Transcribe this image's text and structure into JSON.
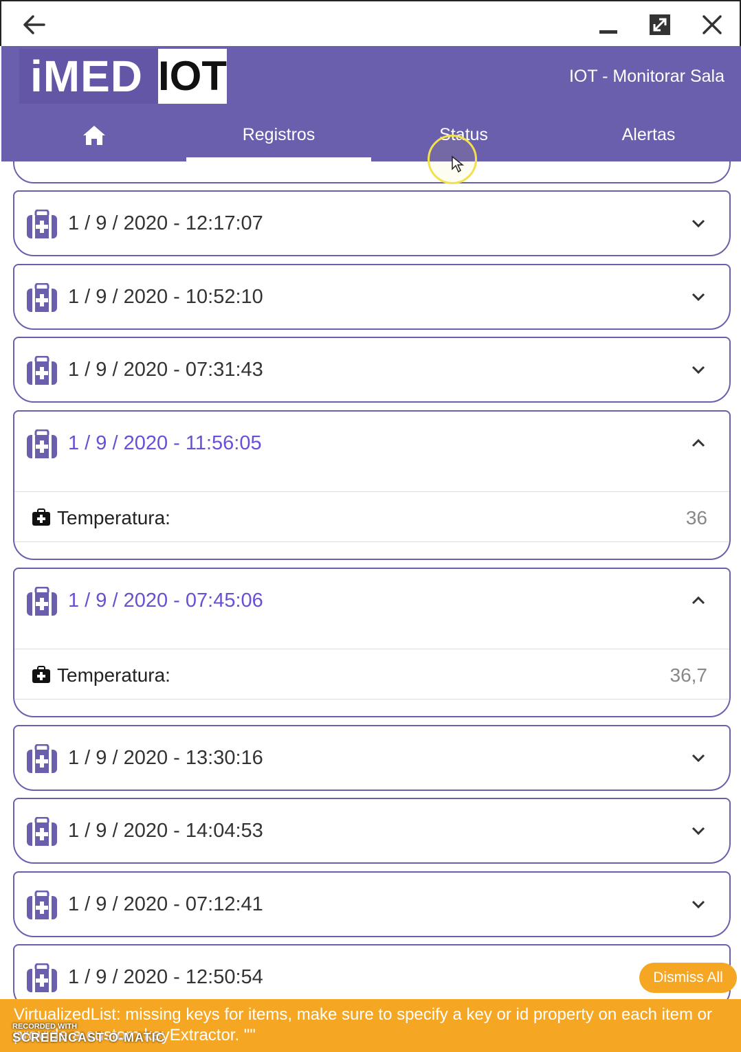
{
  "header": {
    "logo_left": "iMED",
    "logo_right": "IOT",
    "title": "IOT - Monitorar Sala"
  },
  "tabs": [
    {
      "label": "",
      "icon": "home-icon"
    },
    {
      "label": "Registros",
      "active": true
    },
    {
      "label": "Status"
    },
    {
      "label": "Alertas"
    }
  ],
  "records": [
    {
      "date": "1 / 9 / 2020 - 12:17:07",
      "expanded": false
    },
    {
      "date": "1 / 9 / 2020 - 10:52:10",
      "expanded": false
    },
    {
      "date": "1 / 9 / 2020 - 07:31:43",
      "expanded": false
    },
    {
      "date": "1 / 9 / 2020 - 11:56:05",
      "expanded": true,
      "detail_label": "Temperatura:",
      "detail_value": "36"
    },
    {
      "date": "1 / 9 / 2020 - 07:45:06",
      "expanded": true,
      "detail_label": "Temperatura:",
      "detail_value": "36,7"
    },
    {
      "date": "1 / 9 / 2020 - 13:30:16",
      "expanded": false
    },
    {
      "date": "1 / 9 / 2020 - 14:04:53",
      "expanded": false
    },
    {
      "date": "1 / 9 / 2020 - 07:12:41",
      "expanded": false
    },
    {
      "date": "1 / 9 / 2020 - 12:50:54",
      "expanded": false
    }
  ],
  "warning": {
    "dismiss_label": "Dismiss All",
    "message": "VirtualizedList: missing keys for items, make sure to specify a key or id property on each item or provide a custom keyExtractor. \"\""
  },
  "watermark": {
    "recorded_with": "RECORDED WITH",
    "brand": "SCREENCAST-O-MATIC"
  },
  "colors": {
    "brand": "#6a5fad",
    "active_date": "#6a4fd6",
    "warning": "#f5a623"
  }
}
